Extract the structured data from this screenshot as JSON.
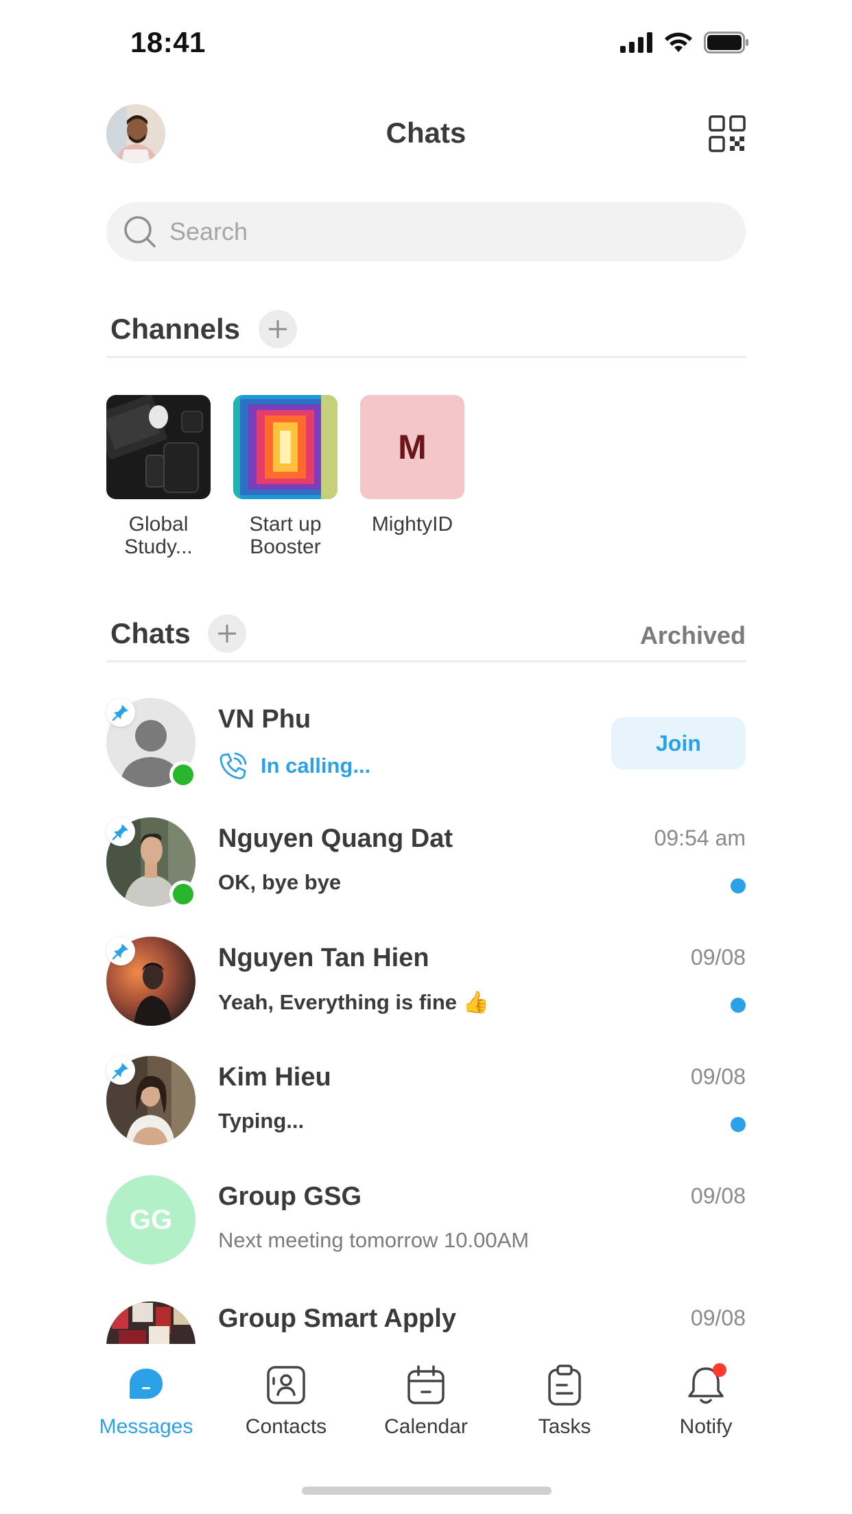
{
  "status_bar": {
    "time": "18:41"
  },
  "header": {
    "title": "Chats"
  },
  "search": {
    "placeholder": "Search"
  },
  "channels": {
    "title": "Channels",
    "items": [
      {
        "name_line1": "Global",
        "name_line2": "Study..."
      },
      {
        "name_line1": "Start up",
        "name_line2": "Booster"
      },
      {
        "name_line1": "MightyID",
        "name_line2": "",
        "initial": "M"
      }
    ]
  },
  "chats": {
    "title": "Chats",
    "archived_label": "Archived",
    "items": [
      {
        "name": "VN Phu",
        "preview": "In calling...",
        "action": "Join",
        "pinned": true,
        "online": true
      },
      {
        "name": "Nguyen Quang Dat",
        "preview": "OK, bye bye",
        "time": "09:54 am",
        "pinned": true,
        "online": true,
        "unread": true
      },
      {
        "name": "Nguyen Tan Hien",
        "preview": "Yeah, Everything is fine 👍",
        "time": "09/08",
        "pinned": true,
        "unread": true
      },
      {
        "name": "Kim Hieu",
        "preview": "Typing...",
        "time": "09/08",
        "pinned": true,
        "unread": true
      },
      {
        "name": "Group GSG",
        "preview": "Next meeting tomorrow 10.00AM",
        "time": "09/08",
        "initials": "GG"
      },
      {
        "name": "Group Smart Apply",
        "time": "09/08"
      }
    ]
  },
  "bottom_nav": {
    "items": [
      {
        "label": "Messages",
        "active": true
      },
      {
        "label": "Contacts"
      },
      {
        "label": "Calendar"
      },
      {
        "label": "Tasks"
      },
      {
        "label": "Notify",
        "badge": true
      }
    ]
  },
  "colors": {
    "accent": "#2ba1e8",
    "online": "#28b52b",
    "notify_badge": "#ff3b30",
    "mighty_bg": "#f3c7c9",
    "gsg_bg": "#b2f0c8"
  }
}
